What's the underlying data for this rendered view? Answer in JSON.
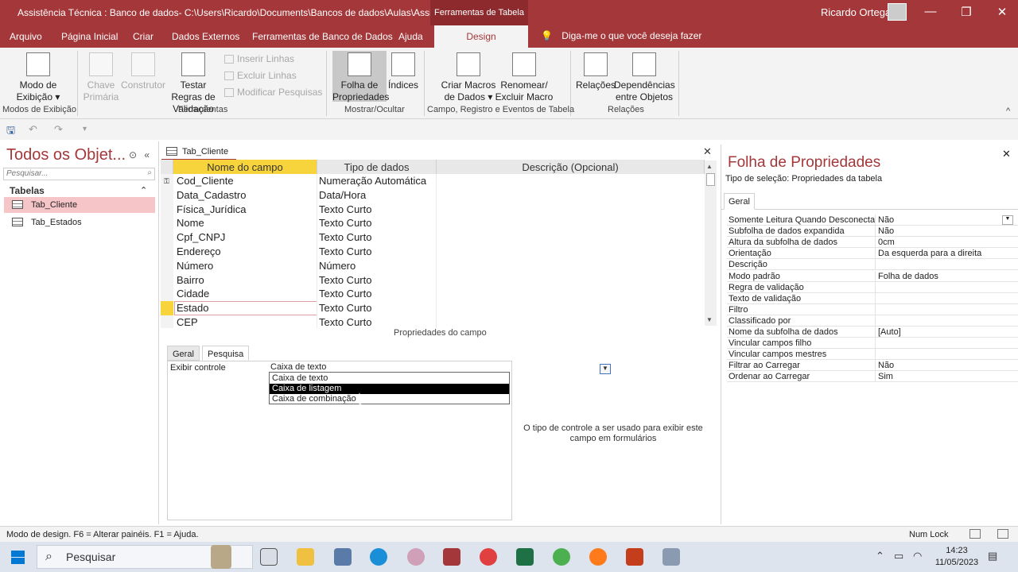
{
  "window": {
    "title": "Assistência Técnica : Banco de dados- C:\\Users\\Ricardo\\Documents\\Bancos de dados\\Aulas\\Assistên...",
    "context_tab": "Ferramentas de Tabela",
    "user": "Ricardo Ortega",
    "minimize": "—",
    "restore": "❐",
    "close": "✕"
  },
  "menu": {
    "tabs": [
      "Arquivo",
      "Página Inicial",
      "Criar",
      "Dados Externos",
      "Ferramentas de Banco de Dados",
      "Ajuda",
      "Design"
    ],
    "tell_me": "Diga-me o que você deseja fazer"
  },
  "ribbon": {
    "modo_exibicao": "Modo de Exibição ▾",
    "chave_primaria": "Chave Primária",
    "construtor": "Construtor",
    "testar_regras": "Testar Regras de Validação",
    "inserir_linhas": "Inserir Linhas",
    "excluir_linhas": "Excluir Linhas",
    "modificar_pesquisas": "Modificar Pesquisas",
    "folha_propriedades": "Folha de Propriedades",
    "indices": "Índices",
    "criar_macros": "Criar Macros de Dados ▾",
    "renomear_macro": "Renomear/ Excluir Macro",
    "relacoes": "Relações",
    "dependencias": "Dependências entre Objetos",
    "groups": [
      "Modos de Exibição",
      "Ferramentas",
      "Mostrar/Ocultar",
      "Campo, Registro e Eventos de Tabela",
      "Relações"
    ],
    "collapse": "^"
  },
  "nav": {
    "title": "Todos os Objet...",
    "search_placeholder": "Pesquisar...",
    "group": "Tabelas",
    "items": [
      "Tab_Cliente",
      "Tab_Estados"
    ]
  },
  "document": {
    "tab": "Tab_Cliente",
    "columns": [
      "Nome do campo",
      "Tipo de dados",
      "Descrição (Opcional)"
    ],
    "rows": [
      {
        "name": "Cod_Cliente",
        "type": "Numeração Automática"
      },
      {
        "name": "Data_Cadastro",
        "type": "Data/Hora"
      },
      {
        "name": "Física_Jurídica",
        "type": "Texto Curto"
      },
      {
        "name": "Nome",
        "type": "Texto Curto"
      },
      {
        "name": "Cpf_CNPJ",
        "type": "Texto Curto"
      },
      {
        "name": "Endereço",
        "type": "Texto Curto"
      },
      {
        "name": "Número",
        "type": "Número"
      },
      {
        "name": "Bairro",
        "type": "Texto Curto"
      },
      {
        "name": "Cidade",
        "type": "Texto Curto"
      },
      {
        "name": "Estado",
        "type": "Texto Curto"
      },
      {
        "name": "CEP",
        "type": "Texto Curto"
      }
    ],
    "selected_row": "Estado",
    "field_props_label": "Propriedades do campo",
    "field_tabs": [
      "Geral",
      "Pesquisa"
    ],
    "active_field_tab": "Pesquisa",
    "exibir_controle_label": "Exibir controle",
    "exibir_controle_value": "Caixa de texto",
    "dropdown_options": [
      "Caixa de texto",
      "Caixa de listagem",
      "Caixa de combinação"
    ],
    "highlighted_option": "Caixa de listagem",
    "help_text": "O tipo de controle a ser usado para exibir este campo em formulários"
  },
  "property_sheet": {
    "title": "Folha de Propriedades",
    "selection": "Tipo de seleção:  Propriedades da tabela",
    "tab": "Geral",
    "rows": [
      {
        "label": "Somente Leitura Quando Desconectado",
        "value": "Não"
      },
      {
        "label": "Subfolha de dados expandida",
        "value": "Não"
      },
      {
        "label": "Altura da subfolha de dados",
        "value": "0cm"
      },
      {
        "label": "Orientação",
        "value": "Da esquerda para a direita"
      },
      {
        "label": "Descrição",
        "value": ""
      },
      {
        "label": "Modo padrão",
        "value": "Folha de dados"
      },
      {
        "label": "Regra de validação",
        "value": ""
      },
      {
        "label": "Texto de validação",
        "value": ""
      },
      {
        "label": "Filtro",
        "value": ""
      },
      {
        "label": "Classificado por",
        "value": ""
      },
      {
        "label": "Nome da subfolha de dados",
        "value": "[Auto]"
      },
      {
        "label": "Vincular campos filho",
        "value": ""
      },
      {
        "label": "Vincular campos mestres",
        "value": ""
      },
      {
        "label": "Filtrar ao Carregar",
        "value": "Não"
      },
      {
        "label": "Ordenar ao Carregar",
        "value": "Sim"
      }
    ]
  },
  "status": {
    "text": "Modo de design.  F6 = Alterar painéis.  F1 = Ajuda.",
    "numlock": "Num Lock"
  },
  "taskbar": {
    "search": "Pesquisar",
    "time": "14:23",
    "date": "11/05/2023"
  },
  "colors": {
    "access_red": "#a4373a",
    "selection_yellow": "#f8d43c",
    "nav_selected": "#f6c5c8"
  }
}
